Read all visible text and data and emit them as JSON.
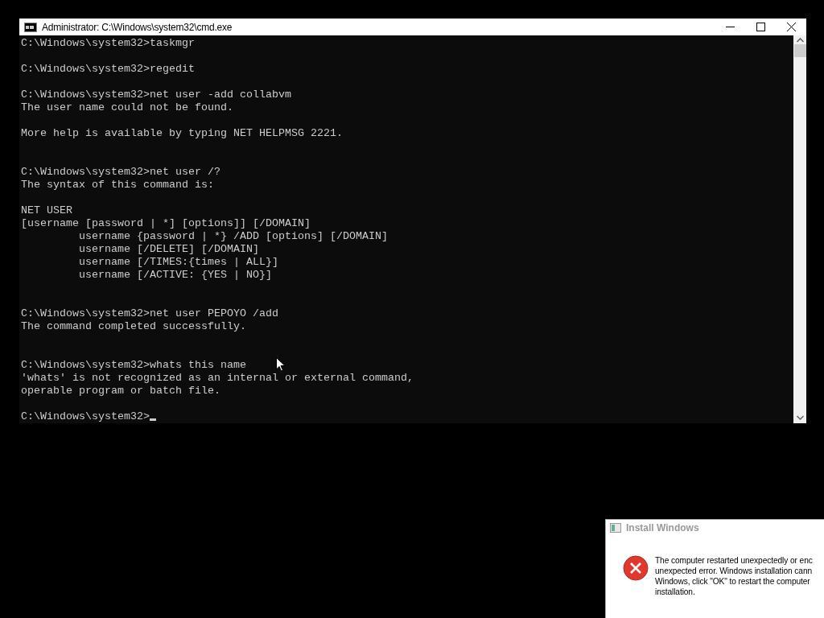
{
  "console_window": {
    "title": "Administrator: C:\\Windows\\system32\\cmd.exe",
    "blocks": [
      {
        "kind": "single",
        "lines": [
          "C:\\Windows\\system32>taskmgr"
        ]
      },
      {
        "kind": "single",
        "lines": [
          "C:\\Windows\\system32>regedit"
        ]
      },
      {
        "kind": "single",
        "lines": [
          "C:\\Windows\\system32>net user -add collabvm",
          "The user name could not be found."
        ]
      },
      {
        "kind": "double",
        "lines": [
          "More help is available by typing NET HELPMSG 2221."
        ]
      },
      {
        "kind": "single",
        "lines": [
          "C:\\Windows\\system32>net user /?",
          "The syntax of this command is:"
        ]
      },
      {
        "kind": "double",
        "lines": [
          "NET USER",
          "[username [password | *] [options]] [/DOMAIN]",
          "         username {password | *} /ADD [options] [/DOMAIN]",
          "         username [/DELETE] [/DOMAIN]",
          "         username [/TIMES:{times | ALL}]",
          "         username [/ACTIVE: {YES | NO}]"
        ]
      },
      {
        "kind": "double",
        "lines": [
          "C:\\Windows\\system32>net user PEPOYO /add",
          "The command completed successfully."
        ]
      },
      {
        "kind": "single",
        "lines": [
          "C:\\Windows\\system32>whats this name",
          "'whats' is not recognized as an internal or external command,",
          "operable program or batch file."
        ]
      }
    ],
    "prompt": "C:\\Windows\\system32>"
  },
  "dialog": {
    "title": "Install Windows",
    "active": false,
    "message_lines": [
      "The computer restarted unexpectedly or enc",
      "unexpected error. Windows installation cann",
      "Windows, click \"OK\" to restart the computer",
      "installation."
    ]
  }
}
